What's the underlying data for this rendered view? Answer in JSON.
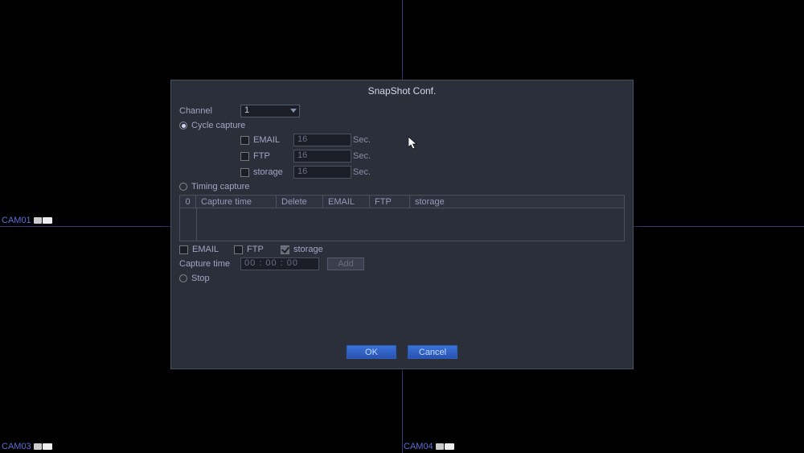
{
  "cams": {
    "c1": "CAM01",
    "c3": "CAM03",
    "c4": "CAM04"
  },
  "dialog": {
    "title": "SnapShot Conf.",
    "channel_label": "Channel",
    "channel_value": "1",
    "mode_cycle": "Cycle capture",
    "mode_timing": "Timing capture",
    "mode_stop": "Stop",
    "cycle": {
      "email_label": "EMAIL",
      "email_val": "16",
      "ftp_label": "FTP",
      "ftp_val": "16",
      "storage_label": "storage",
      "storage_val": "16",
      "unit": "Sec."
    },
    "table": {
      "c0": "0",
      "c1": "Capture time",
      "c2": "Delete",
      "c3": "EMAIL",
      "c4": "FTP",
      "c5": "storage"
    },
    "add": {
      "email": "EMAIL",
      "ftp": "FTP",
      "storage": "storage",
      "captime_label": "Capture time",
      "captime_val": "00  : 00  : 00",
      "add_btn": "Add"
    },
    "ok": "OK",
    "cancel": "Cancel"
  }
}
